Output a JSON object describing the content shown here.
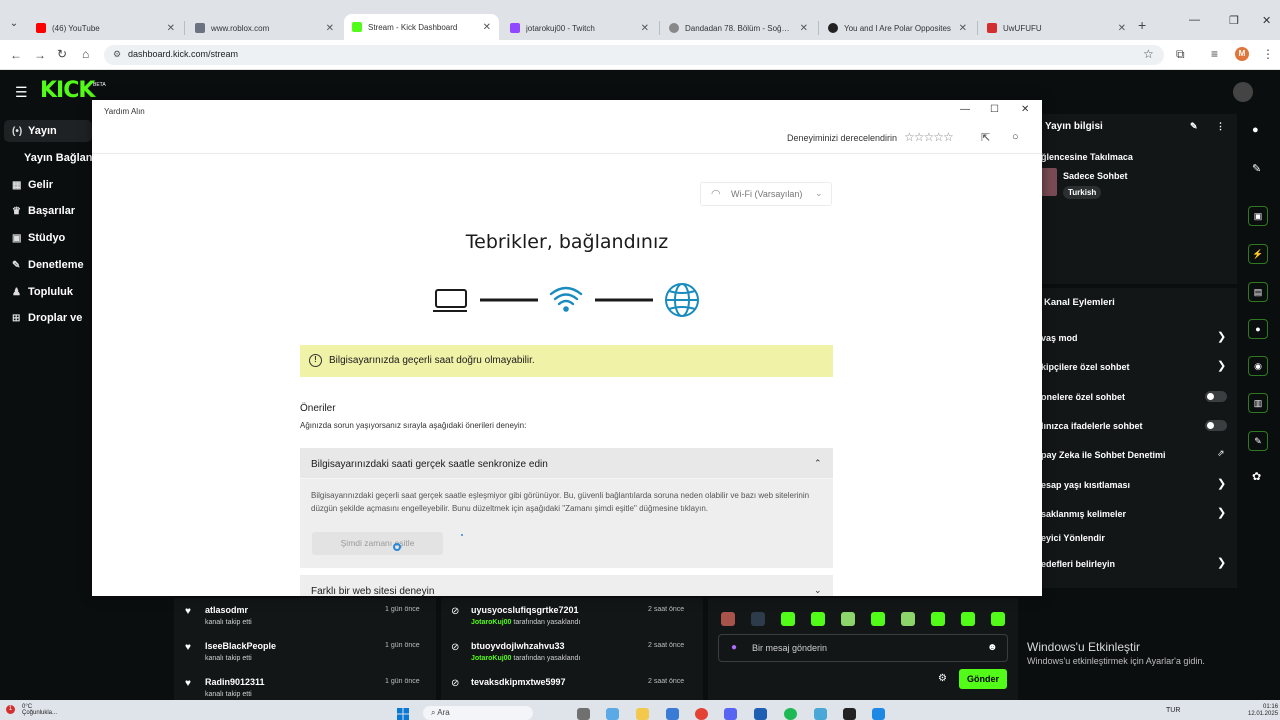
{
  "browser": {
    "tabs": [
      {
        "label": "(46) YouTube",
        "color": "#ff0000"
      },
      {
        "label": "www.roblox.com",
        "color": "#6b7280"
      },
      {
        "label": "Stream - Kick Dashboard",
        "color": "#53fc18"
      },
      {
        "label": "jotarokuj00 - Twitch",
        "color": "#9146ff"
      },
      {
        "label": "Dandadan 78. Bölüm - Soğuk T",
        "color": "#888888"
      },
      {
        "label": "You and I Are Polar Opposites",
        "color": "#222222"
      },
      {
        "label": "UwUFUFU",
        "color": "#d32f2f"
      }
    ],
    "url": "dashboard.kick.com/stream",
    "profile_initial": "M"
  },
  "kick": {
    "beta": "BETA",
    "sidebar": [
      {
        "label": "Yayın",
        "icon": "broadcast-icon"
      },
      {
        "label": "Yayın Bağlant",
        "icon": ""
      },
      {
        "label": "Gelir",
        "icon": "chart-icon"
      },
      {
        "label": "Başarılar",
        "icon": "trophy-icon"
      },
      {
        "label": "Stüdyo",
        "icon": "studio-icon"
      },
      {
        "label": "Denetleme",
        "icon": "wrench-icon"
      },
      {
        "label": "Topluluk",
        "icon": "community-icon"
      },
      {
        "label": "Droplar ve",
        "icon": "drops-icon"
      }
    ],
    "stream_info": {
      "title": "Yayın bilgisi",
      "stream_title": "ğlencesine Takılmaca",
      "category": "Sadece Sohbet",
      "tag": "Turkish"
    },
    "channel_actions": {
      "title": "Kanal Eylemleri",
      "items": [
        {
          "label": "vaş mod",
          "control": "chevron"
        },
        {
          "label": "kipçilere özel sohbet",
          "control": "chevron"
        },
        {
          "label": "onelere özel sohbet",
          "control": "toggle"
        },
        {
          "label": "lınızca ifadelerle sohbet",
          "control": "toggle"
        },
        {
          "label": "pay Zeka ile Sohbet Denetimi",
          "control": "external"
        },
        {
          "label": "esap yaşı kısıtlaması",
          "control": "chevron"
        },
        {
          "label": "saklanmış kelimeler",
          "control": "chevron"
        },
        {
          "label": "eyici Yönlendir",
          "control": "none"
        },
        {
          "label": "edefleri belirleyin",
          "control": "chevron"
        }
      ]
    },
    "follows": [
      {
        "name": "atlasodmr",
        "sub": "kanalı takip etti",
        "time": "1 gün önce"
      },
      {
        "name": "IseeBlackPeople",
        "sub": "kanalı takip etti",
        "time": "1 gün önce"
      },
      {
        "name": "Radin9012311",
        "sub": "kanalı takip etti",
        "time": "1 gün önce"
      }
    ],
    "bans": [
      {
        "name": "uyusyocslufiqsgrtke7201",
        "by": "JotaroKuj00",
        "sub": "tarafından yasaklandı",
        "time": "2 saat önce"
      },
      {
        "name": "btuoyvdojlwhzahvu33",
        "by": "JotaroKuj00",
        "sub": "tarafından yasaklandı",
        "time": "2 saat önce"
      },
      {
        "name": "tevaksdkipmxtwe5997",
        "by": "",
        "sub": "",
        "time": "2 saat önce"
      }
    ],
    "chat": {
      "placeholder": "Bir mesaj gönderin",
      "send": "Gönder"
    }
  },
  "dialog": {
    "window_title": "Yardım Alın",
    "rate_label": "Deneyiminizi derecelendirin",
    "stars": "☆☆☆☆☆",
    "network": "Wi-Fi (Varsayılan)",
    "headline": "Tebrikler, bağlandınız",
    "warning": "Bilgisayarınızda geçerli saat doğru olmayabilir.",
    "suggestions_title": "Öneriler",
    "suggestions_subtitle": "Ağınızda sorun yaşıyorsanız sırayla aşağıdaki önerileri deneyin:",
    "accordion1": {
      "title": "Bilgisayarınızdaki saati gerçek saatle senkronize edin",
      "body": "Bilgisayarınızdaki geçerli saat gerçek saatle eşleşmiyor gibi görünüyor. Bu, güvenli bağlantılarda soruna neden olabilir ve bazı web sitelerinin düzgün şekilde açmasını engelleyebilir. Bunu düzeltmek için aşağıdaki \"Zamanı şimdi eşitle\" düğmesine tıklayın.",
      "button": "Şimdi zamanı eşitle"
    },
    "accordion2": {
      "title": "Farklı bir web sitesi deneyin"
    }
  },
  "windows": {
    "activate_title": "Windows'u Etkinleştir",
    "activate_sub": "Windows'u etkinleştirmek için Ayarlar'a gidin."
  },
  "taskbar": {
    "weather_badge": "1",
    "temperature": "0°C",
    "weather_desc": "Çoğunlukla...",
    "search": "Ara",
    "lang": "TUR",
    "time": "01:16",
    "date": "12.01.2025"
  },
  "colors": {
    "kick_green": "#53fc18",
    "warning_bg": "#f0f2a8",
    "wifi_blue": "#1a8bbf"
  }
}
